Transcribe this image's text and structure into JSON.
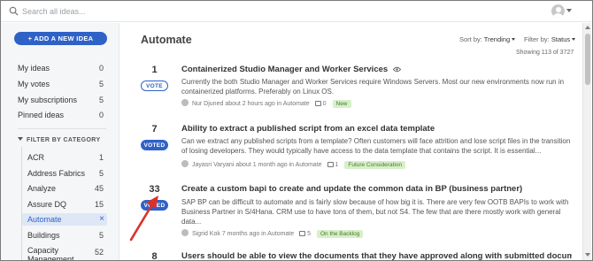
{
  "search": {
    "placeholder": "Search all ideas..."
  },
  "sidebar": {
    "add_button": "+ ADD A NEW IDEA",
    "nav": [
      {
        "label": "My ideas",
        "count": "0"
      },
      {
        "label": "My votes",
        "count": "5"
      },
      {
        "label": "My subscriptions",
        "count": "5"
      },
      {
        "label": "Pinned ideas",
        "count": "0"
      }
    ],
    "filter_heading": "FILTER BY CATEGORY",
    "categories": [
      {
        "label": "ACR",
        "count": "1"
      },
      {
        "label": "Address Fabrics",
        "count": "5"
      },
      {
        "label": "Analyze",
        "count": "45"
      },
      {
        "label": "Assure DQ",
        "count": "15"
      },
      {
        "label": "Automate",
        "count": "×",
        "active": true
      },
      {
        "label": "Buildings",
        "count": "5"
      },
      {
        "label": "Capacity Management",
        "count": "52"
      }
    ]
  },
  "main": {
    "title": "Automate",
    "sort_label": "Sort by:",
    "sort_value": "Trending",
    "filter_label": "Filter by:",
    "filter_value": "Status",
    "showing": "Showing 113 of 3727",
    "ideas": [
      {
        "votes": "1",
        "vote_label": "VOTE",
        "voted": false,
        "title": "Containerized Studio Manager and Worker Services",
        "description": "Currently the both Studio Manager and Worker Services require Windows Servers. Most our new environments now run in containerized platforms. Preferably on Linux OS.",
        "author": "Nur Djuned",
        "time": "about 2 hours ago in Automate",
        "comments": "0",
        "status": "New"
      },
      {
        "votes": "7",
        "vote_label": "VOTED",
        "voted": true,
        "title": "Ability to extract a published script from an excel data template",
        "description": "Can we extract any published scripts from a template? Often customers will face attrition and lose script files in the transition of losing developers. They would typically have access to the data template that contains the script. It is essential...",
        "author": "Jayasri Varyani",
        "time": "about 1 month ago in Automate",
        "comments": "1",
        "status": "Future Consideration"
      },
      {
        "votes": "33",
        "vote_label": "VOTED",
        "voted": true,
        "title": "Create a custom bapi to create and update the common data in BP (business partner)",
        "description": "SAP BP can be difficult to automate and is fairly slow because of how big it is. There are very few OOTB BAPIs to work with Business Partner in S/4Hana. CRM use to have tons of them, but not S4. The few that are there mostly work with general data...",
        "author": "Sigrid Kok",
        "time": "7 months ago in Automate",
        "comments": "5",
        "status": "On the Backlog"
      },
      {
        "votes": "8",
        "title": "Users should be able to view the documents that they have approved along with submitted documents."
      }
    ]
  },
  "colors": {
    "accent": "#2f62c7",
    "tag_bg": "#d6f0c9",
    "tag_text": "#4b7a2e",
    "arrow": "#d9322b"
  }
}
